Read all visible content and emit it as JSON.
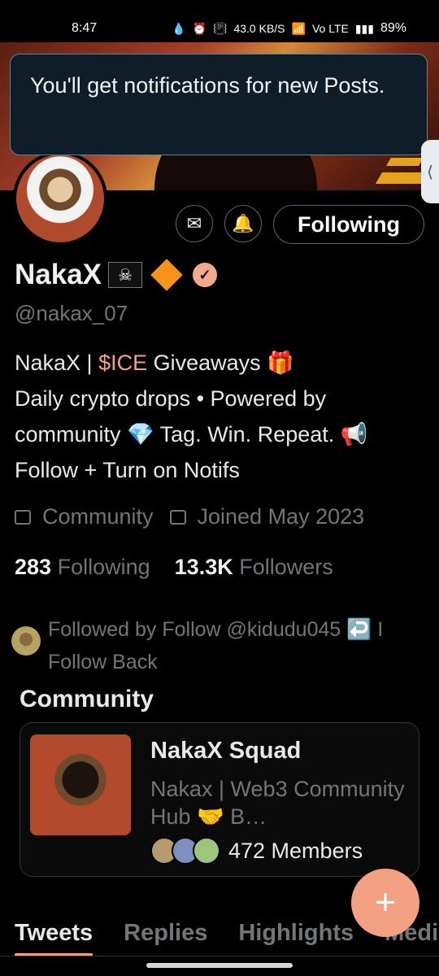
{
  "status_bar": {
    "time": "8:47",
    "network_speed": "43.0",
    "network_speed_unit": "KB/S",
    "volte": "Vo LTE",
    "battery": "89%"
  },
  "toast": {
    "message": "You'll get notifications for new Posts."
  },
  "profile": {
    "display_name": "NakaX",
    "flag_icon": "pirate-flag-icon",
    "handle": "@nakax_07",
    "bio_lines": [
      "Giveaways 🎁",
      "Daily crypto drops • Powered by",
      "community 💎 Tag. Win. Repeat. 📢",
      "Follow + Turn on Notifs"
    ],
    "bio_prefix": "NakaX | ",
    "bio_cashtag": "$ICE",
    "meta": {
      "category": "Community",
      "joined": "Joined May 2023"
    },
    "stats": {
      "following_count": "283",
      "following_label": "Following",
      "followers_count": "13.3K",
      "followers_label": "Followers"
    },
    "followed_by": "Followed by Follow @kidudu045 ↩️ I Follow Back"
  },
  "actions": {
    "following_label": "Following"
  },
  "community": {
    "section_title": "Community",
    "name": "NakaX Squad",
    "description": "Nakax | Web3 Community Hub 🤝 B…",
    "members": "472 Members"
  },
  "tabs": [
    "Tweets",
    "Replies",
    "Highlights",
    "Media"
  ],
  "fab": {
    "icon": "plus-icon"
  },
  "colors": {
    "accent": "#f4a183",
    "cashtag": "#f6a083",
    "muted": "#71767b"
  }
}
